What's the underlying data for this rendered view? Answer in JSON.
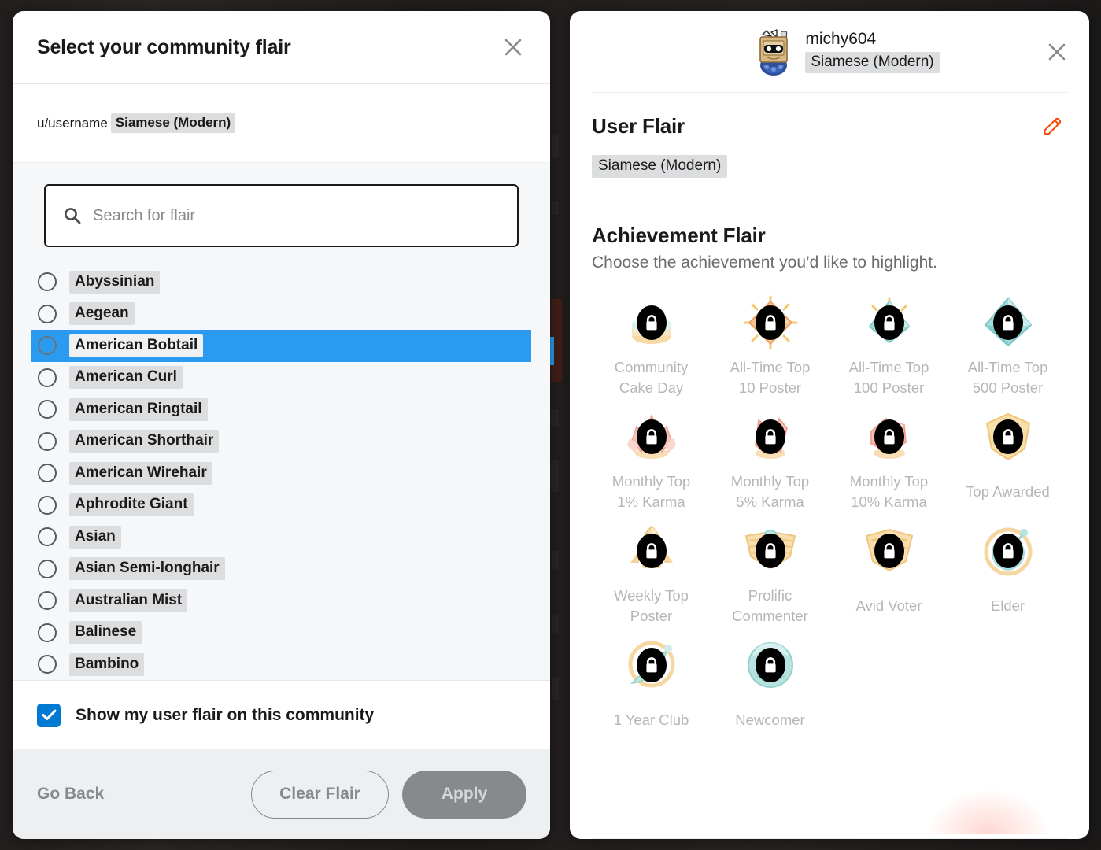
{
  "left_modal": {
    "title": "Select your community flair",
    "close_icon": "close-icon",
    "preview": {
      "username": "u/username",
      "flair_text": "Siamese (Modern)"
    },
    "search": {
      "placeholder": "Search for flair",
      "value": "",
      "icon": "search-icon"
    },
    "flair_options": [
      {
        "label": "Abyssinian",
        "selected": false
      },
      {
        "label": "Aegean",
        "selected": false
      },
      {
        "label": "American Bobtail",
        "selected": true
      },
      {
        "label": "American Curl",
        "selected": false
      },
      {
        "label": "American Ringtail",
        "selected": false
      },
      {
        "label": "American Shorthair",
        "selected": false
      },
      {
        "label": "American Wirehair",
        "selected": false
      },
      {
        "label": "Aphrodite Giant",
        "selected": false
      },
      {
        "label": "Asian",
        "selected": false
      },
      {
        "label": "Asian Semi-longhair",
        "selected": false
      },
      {
        "label": "Australian Mist",
        "selected": false
      },
      {
        "label": "Balinese",
        "selected": false
      },
      {
        "label": "Bambino",
        "selected": false
      }
    ],
    "checkbox": {
      "label": "Show my user flair on this community",
      "checked": true
    },
    "footer": {
      "go_back": "Go Back",
      "clear_flair": "Clear Flair",
      "apply": "Apply",
      "apply_disabled": true
    },
    "colors": {
      "selected_row": "#2a9bf0",
      "checkbox": "#0079d3",
      "apply_disabled_bg": "#878a8c"
    }
  },
  "right_modal": {
    "username": "michy604",
    "header_flair": "Siamese (Modern)",
    "close_icon": "close-icon",
    "avatar_icon": "avatar",
    "user_flair": {
      "title": "User Flair",
      "value": "Siamese (Modern)",
      "edit_icon": "pencil-icon",
      "edit_icon_color": "#ff4500"
    },
    "achievement_flair": {
      "title": "Achievement Flair",
      "subtitle": "Choose the achievement you’d like to highlight.",
      "items": [
        {
          "label": "Community\nCake Day",
          "icon": "cake-badge-icon",
          "locked": true
        },
        {
          "label": "All-Time Top\n10 Poster",
          "icon": "diamond-orange-icon",
          "locked": true
        },
        {
          "label": "All-Time Top\n100 Poster",
          "icon": "diamond-teal-icon",
          "locked": true
        },
        {
          "label": "All-Time Top\n500 Poster",
          "icon": "gem-teal-icon",
          "locked": true
        },
        {
          "label": "Monthly Top\n1% Karma",
          "icon": "crystal-pink-icon",
          "locked": true
        },
        {
          "label": "Monthly Top\n5% Karma",
          "icon": "crystal-pink-2-icon",
          "locked": true
        },
        {
          "label": "Monthly Top\n10% Karma",
          "icon": "crystal-pink-3-icon",
          "locked": true
        },
        {
          "label": "Top Awarded",
          "icon": "shield-gold-icon",
          "locked": true
        },
        {
          "label": "Weekly Top\nPoster",
          "icon": "rocket-icon",
          "locked": true
        },
        {
          "label": "Prolific\nCommenter",
          "icon": "wings-icon",
          "locked": true
        },
        {
          "label": "Avid Voter",
          "icon": "chevron-badge-icon",
          "locked": true
        },
        {
          "label": "Elder",
          "icon": "orbit-icon",
          "locked": true
        },
        {
          "label": "1 Year Club",
          "icon": "comet-icon",
          "locked": true
        },
        {
          "label": "Newcomer",
          "icon": "sphere-icon",
          "locked": true
        }
      ]
    }
  }
}
